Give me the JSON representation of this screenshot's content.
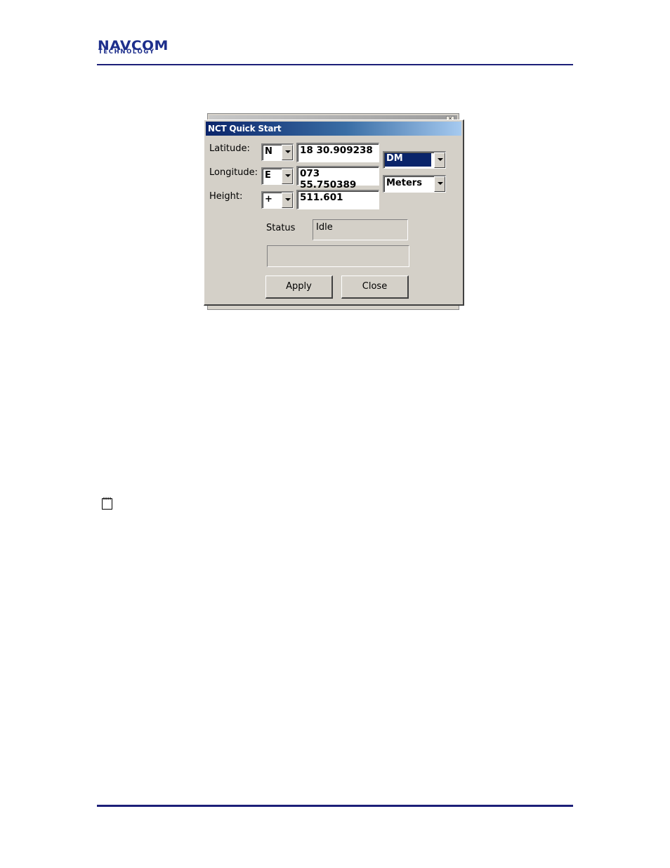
{
  "header": {
    "logo_main": "NAVCOM",
    "logo_sub": "TECHNOLOGY",
    "logo_color": "#1e2f8c",
    "rule_color": "#1c1f78"
  },
  "window": {
    "title": "NCT Quick Start",
    "latitude_label": "Latitude:",
    "longitude_label": "Longitude:",
    "height_label": "Height:",
    "latitude_hemisphere": "N",
    "longitude_hemisphere": "E",
    "height_sign": "+",
    "latitude_value": "18 30.909238",
    "longitude_value": "073 55.750389",
    "height_value": "511.601",
    "format_selected": "DM",
    "units_selected": "Meters",
    "status_label": "Status",
    "status_value": "Idle",
    "progress_text": "",
    "apply_label": "Apply",
    "close_label": "Close"
  },
  "colors": {
    "dialog_face": "#d4d0c8",
    "title_start": "#0a246a",
    "title_end": "#a6caf0",
    "selection": "#0a246a"
  },
  "icons": [
    "navcom-logo",
    "note-icon",
    "dropdown-arrow-icon"
  ]
}
